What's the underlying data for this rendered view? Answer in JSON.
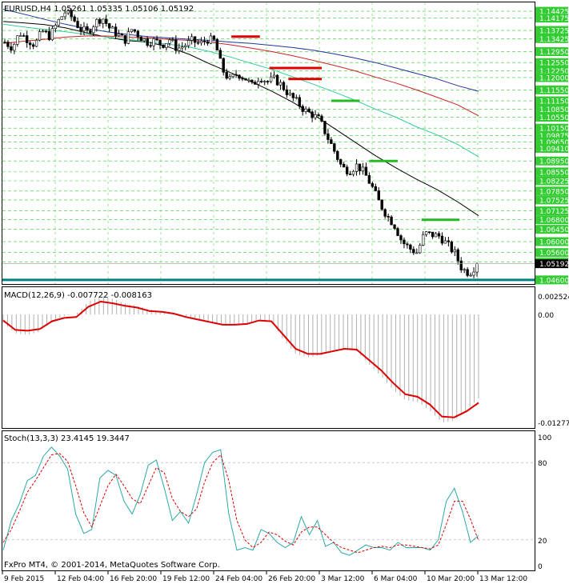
{
  "window": {
    "header": "EURUSD,H4  1.05261 1.05335 1.05106 1.05192",
    "footer": "FxPro MT4, © 2001-2014, MetaQuotes Software Corp."
  },
  "colors": {
    "background": "#ffffff",
    "grid": "#33cc33",
    "candle": "#000000",
    "ma_fast": "#000000",
    "ma_green": "#33cc99",
    "ma_red": "#cc2222",
    "ma_blue": "#223399",
    "support_line": "#008080",
    "macd_signal": "#dd0000",
    "macd_hist": "#b0b0b0",
    "stoch_main": "#2aa8a8",
    "stoch_signal": "#dd0000",
    "level_red": "#dd0000",
    "level_green": "#22bb22",
    "price_label_bg": "#33cc33"
  },
  "chart_data": [
    {
      "type": "candlestick",
      "title": "EURUSD,H4",
      "ohlc_last": {
        "open": 1.05261,
        "high": 1.05335,
        "low": 1.05106,
        "close": 1.05192
      },
      "x_tick_labels": [
        "9 Feb 2015",
        "12 Feb 04:00",
        "16 Feb 20:00",
        "19 Feb 12:00",
        "24 Feb 04:00",
        "26 Feb 20:00",
        "3 Mar 12:00",
        "6 Mar 04:00",
        "10 Mar 20:00",
        "13 Mar 12:00"
      ],
      "y_tick_labels": [
        1.14425,
        1.14175,
        1.13725,
        1.13425,
        1.1295,
        1.1255,
        1.1225,
        1.12,
        1.1155,
        1.1115,
        1.1085,
        1.1055,
        1.1015,
        1.09875,
        1.0965,
        1.0941,
        1.0895,
        1.0855,
        1.08225,
        1.0785,
        1.07525,
        1.07125,
        1.068,
        1.0645,
        1.06,
        1.056,
        1.0525,
        1.046
      ],
      "ylim": [
        1.0445,
        1.1475
      ],
      "current_price": 1.05192,
      "support_level": 1.046,
      "close_path": [
        1.133,
        1.131,
        1.1365,
        1.134,
        1.132,
        1.137,
        1.135,
        1.14,
        1.144,
        1.142,
        1.138,
        1.1365,
        1.14,
        1.142,
        1.138,
        1.136,
        1.1335,
        1.138,
        1.135,
        1.133,
        1.1335,
        1.132,
        1.134,
        1.1305,
        1.1318,
        1.1335,
        1.1322,
        1.134,
        1.1333,
        1.123,
        1.119,
        1.1215,
        1.12,
        1.117,
        1.1205,
        1.1185,
        1.1195,
        1.117,
        1.1135,
        1.111,
        1.108,
        1.1065,
        1.1045,
        1.0985,
        1.093,
        1.087,
        1.086,
        1.088,
        1.085,
        1.08,
        1.074,
        1.0695,
        1.066,
        1.06,
        1.0575,
        1.056,
        1.063,
        1.0625,
        1.062,
        1.059,
        1.056,
        1.05,
        1.0485,
        1.0519
      ],
      "levels": [
        {
          "color": "red",
          "price": 1.135
        },
        {
          "color": "red",
          "price": 1.1235
        },
        {
          "color": "red",
          "price": 1.1195
        },
        {
          "color": "green",
          "price": 1.1115
        },
        {
          "color": "green",
          "price": 1.0895
        },
        {
          "color": "green",
          "price": 1.068
        }
      ],
      "moving_averages": [
        {
          "color": "black",
          "values": [
            1.1405,
            1.14,
            1.1394,
            1.1382,
            1.1364,
            1.1348,
            1.1335,
            1.133,
            1.1312,
            1.1285,
            1.125,
            1.1218,
            1.1185,
            1.115,
            1.111,
            1.1065,
            1.1015,
            1.0965,
            1.0915,
            1.087,
            1.0828,
            1.079,
            1.0745,
            1.0695
          ]
        },
        {
          "color": "green",
          "values": [
            1.1395,
            1.1385,
            1.1376,
            1.1368,
            1.1358,
            1.1348,
            1.134,
            1.133,
            1.1322,
            1.1312,
            1.1295,
            1.1275,
            1.1252,
            1.123,
            1.1203,
            1.1176,
            1.1148,
            1.1118,
            1.1085,
            1.1055,
            1.102,
            1.099,
            1.0955,
            1.091
          ]
        },
        {
          "color": "red",
          "values": [
            1.1325,
            1.1333,
            1.134,
            1.1348,
            1.1352,
            1.1352,
            1.1348,
            1.1345,
            1.134,
            1.1336,
            1.133,
            1.132,
            1.1308,
            1.1295,
            1.128,
            1.1263,
            1.1245,
            1.1225,
            1.1202,
            1.118,
            1.1155,
            1.1128,
            1.11,
            1.106
          ]
        },
        {
          "color": "blue",
          "values": [
            1.145,
            1.1432,
            1.1413,
            1.1395,
            1.138,
            1.1368,
            1.1358,
            1.135,
            1.1345,
            1.134,
            1.1336,
            1.133,
            1.1325,
            1.1318,
            1.131,
            1.13,
            1.1287,
            1.1272,
            1.1255,
            1.1235,
            1.1215,
            1.1195,
            1.117,
            1.115
          ]
        }
      ]
    },
    {
      "type": "line",
      "title": "MACD(12,26,9) -0.007722 -0.008163",
      "ylim": [
        -0.012771,
        0.002524
      ],
      "y_tick_labels": [
        "0.002524",
        "0.00",
        "-0.012771"
      ],
      "signal": [
        -0.0007,
        -0.0018,
        -0.0019,
        -0.0017,
        -0.0008,
        -0.0004,
        -0.0003,
        0.0009,
        0.0015,
        0.0013,
        0.001,
        0.0008,
        0.0004,
        0.0003,
        0.0001,
        -0.0003,
        -0.0006,
        -0.0009,
        -0.0012,
        -0.0012,
        -0.0011,
        -0.0007,
        -0.0008,
        -0.0024,
        -0.004,
        -0.0046,
        -0.0046,
        -0.0043,
        -0.004,
        -0.0041,
        -0.0053,
        -0.0065,
        -0.008,
        -0.0093,
        -0.0096,
        -0.0105,
        -0.0119,
        -0.012,
        -0.0113,
        -0.0103
      ],
      "histogram": [
        -0.001,
        -0.0022,
        -0.0024,
        -0.002,
        -0.0008,
        -0.0002,
        0.0001,
        0.0015,
        0.0022,
        0.0018,
        0.0013,
        0.001,
        0.0006,
        0.0004,
        0.0002,
        -0.0002,
        -0.0006,
        -0.001,
        -0.0013,
        -0.0013,
        -0.0012,
        -0.0006,
        -0.0008,
        -0.003,
        -0.0046,
        -0.005,
        -0.0048,
        -0.0044,
        -0.004,
        -0.0043,
        -0.0058,
        -0.0072,
        -0.0088,
        -0.01,
        -0.0102,
        -0.0112,
        -0.0126,
        -0.0124,
        -0.0112,
        -0.0098
      ]
    },
    {
      "type": "line",
      "title": "Stoch(13,3,3) 23.4145 19.3447",
      "ylim": [
        0,
        100
      ],
      "y_tick_labels": [
        "100",
        "80",
        "20",
        "0"
      ],
      "main": [
        12,
        35,
        48,
        66,
        70,
        85,
        92,
        85,
        75,
        40,
        25,
        28,
        68,
        74,
        70,
        50,
        40,
        55,
        78,
        82,
        60,
        35,
        42,
        33,
        55,
        80,
        88,
        90,
        40,
        12,
        14,
        12,
        28,
        25,
        18,
        14,
        18,
        38,
        24,
        35,
        15,
        18,
        10,
        8,
        12,
        16,
        14,
        14,
        12,
        18,
        14,
        14,
        14,
        12,
        20,
        50,
        60,
        42,
        18,
        23.4
      ],
      "signal": [
        18,
        28,
        42,
        57,
        66,
        76,
        86,
        87,
        81,
        62,
        41,
        30,
        46,
        62,
        71,
        62,
        52,
        48,
        62,
        76,
        72,
        52,
        42,
        38,
        44,
        65,
        80,
        86,
        66,
        35,
        20,
        14,
        18,
        26,
        24,
        19,
        16,
        26,
        30,
        30,
        24,
        18,
        14,
        12,
        10,
        12,
        14,
        15,
        14,
        16,
        16,
        15,
        14,
        13,
        16,
        32,
        50,
        50,
        36,
        19.3
      ]
    }
  ]
}
